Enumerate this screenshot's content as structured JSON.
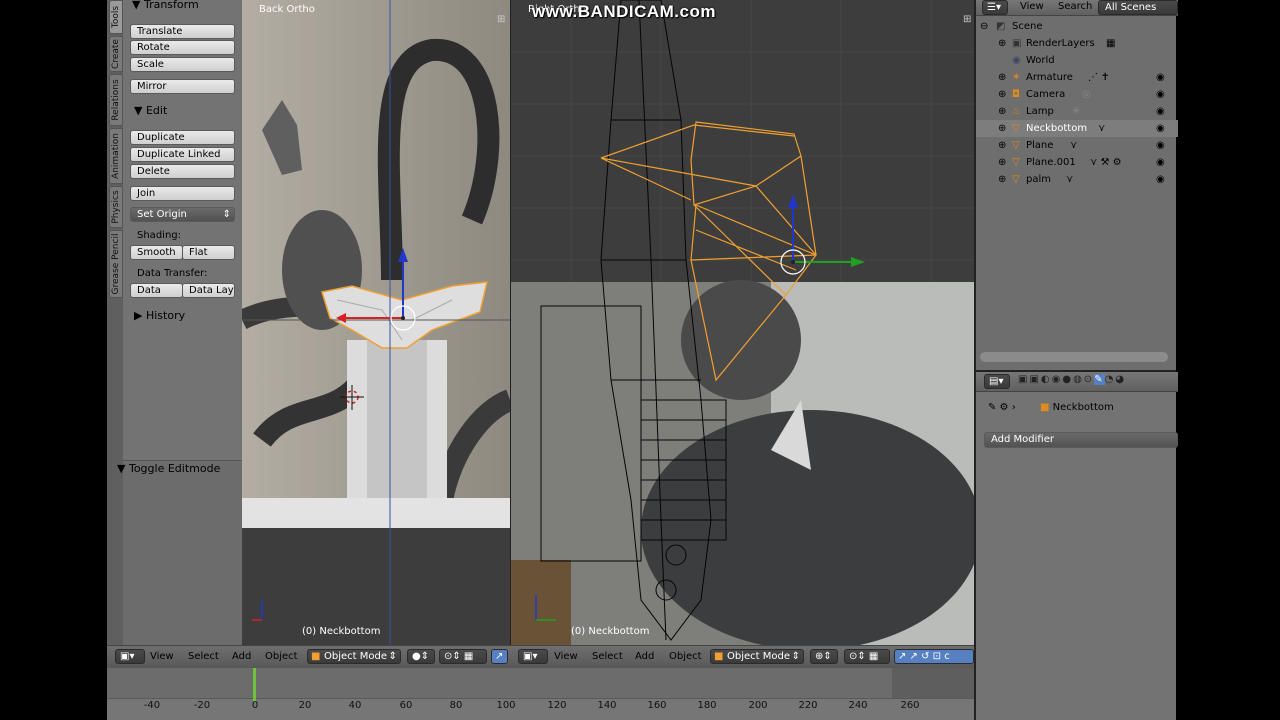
{
  "watermark": "www.BANDICAM.com",
  "tool_shelf": {
    "tabs": [
      "Tools",
      "Create",
      "Relations",
      "Animation",
      "Physics",
      "Grease Pencil"
    ],
    "transform_header": "Transform",
    "translate": "Translate",
    "rotate": "Rotate",
    "scale": "Scale",
    "mirror": "Mirror",
    "edit_header": "Edit",
    "duplicate": "Duplicate",
    "duplicate_linked": "Duplicate Linked",
    "delete": "Delete",
    "join": "Join",
    "set_origin": "Set Origin",
    "shading_label": "Shading:",
    "smooth": "Smooth",
    "flat": "Flat",
    "data_transfer_label": "Data Transfer:",
    "data": "Data",
    "data_layo": "Data Layo",
    "history_header": "History",
    "toggle_editmode": "Toggle Editmode"
  },
  "viewport_left": {
    "label": "Back Ortho",
    "object_label": "(0) Neckbottom",
    "menus": [
      "View",
      "Select",
      "Add",
      "Object"
    ],
    "mode": "Object Mode"
  },
  "viewport_right": {
    "label": "Right Ortho",
    "object_label": "(0) Neckbottom",
    "menus": [
      "View",
      "Select",
      "Add",
      "Object"
    ],
    "mode": "Object Mode"
  },
  "outliner": {
    "menus": [
      "View",
      "Search"
    ],
    "scenes": "All Scenes",
    "items": [
      {
        "name": "Scene",
        "icon": "scene-icon",
        "indent": 0
      },
      {
        "name": "RenderLayers",
        "icon": "renderlayers-icon",
        "indent": 1
      },
      {
        "name": "World",
        "icon": "world-icon",
        "indent": 1
      },
      {
        "name": "Armature",
        "icon": "armature-icon",
        "indent": 1
      },
      {
        "name": "Camera",
        "icon": "camera-icon",
        "indent": 1
      },
      {
        "name": "Lamp",
        "icon": "lamp-icon",
        "indent": 1
      },
      {
        "name": "Neckbottom",
        "icon": "mesh-icon",
        "indent": 1
      },
      {
        "name": "Plane",
        "icon": "mesh-icon",
        "indent": 1
      },
      {
        "name": "Plane.001",
        "icon": "mesh-icon",
        "indent": 1
      },
      {
        "name": "palm",
        "icon": "mesh-icon",
        "indent": 1
      }
    ]
  },
  "properties": {
    "object_name": "Neckbottom",
    "add_modifier": "Add Modifier"
  },
  "timeline": {
    "ticks": [
      "-40",
      "-20",
      "0",
      "20",
      "40",
      "60",
      "80",
      "100",
      "120",
      "140",
      "160",
      "180",
      "200",
      "220",
      "240",
      "260"
    ]
  },
  "colors": {
    "selection_orange": "#f0a030",
    "ui_grey": "#737373",
    "viewport_bg": "#3d3d3d",
    "highlight_blue": "#5680c2"
  }
}
